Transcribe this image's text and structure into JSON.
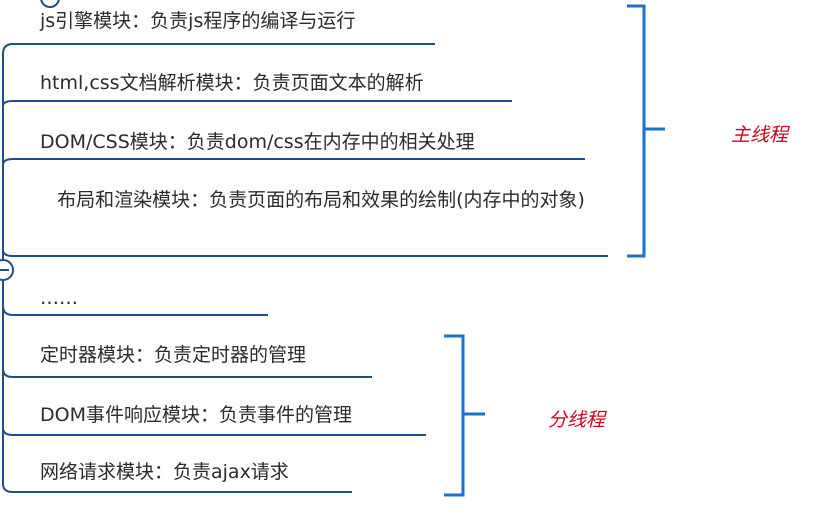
{
  "nodes": [
    {
      "text": "js引擎模块：负责js程序的编译与运行"
    },
    {
      "text": "html,css文档解析模块：负责页面文本的解析"
    },
    {
      "text": "DOM/CSS模块：负责dom/css在内存中的相关处理"
    },
    {
      "text": "布局和渲染模块：负责页面的布局和效果的绘制(内存中的对象)"
    },
    {
      "text": "……"
    },
    {
      "text": "定时器模块：负责定时器的管理"
    },
    {
      "text": "DOM事件响应模块：负责事件的管理"
    },
    {
      "text": "网络请求模块：负责ajax请求"
    }
  ],
  "groups": {
    "main": {
      "label": "主线程"
    },
    "branch": {
      "label": "分线程"
    }
  },
  "colors": {
    "line": "#1f4e8a",
    "bracket": "#1a73c7",
    "label": "#d0021b"
  }
}
